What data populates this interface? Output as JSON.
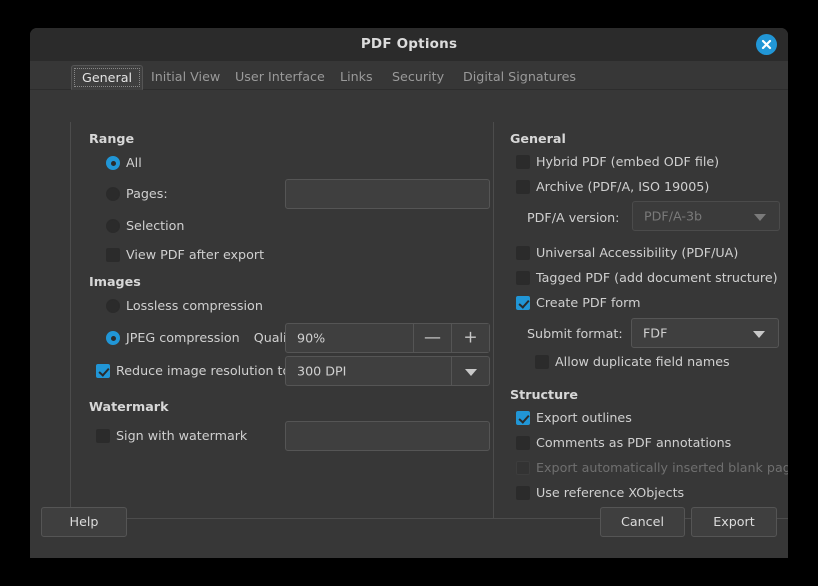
{
  "window": {
    "title": "PDF Options",
    "close_icon": "close-icon"
  },
  "tabs": [
    {
      "label": "General",
      "active": true
    },
    {
      "label": "Initial View",
      "active": false
    },
    {
      "label": "User Interface",
      "active": false
    },
    {
      "label": "Links",
      "active": false
    },
    {
      "label": "Security",
      "active": false
    },
    {
      "label": "Digital Signatures",
      "active": false
    }
  ],
  "left": {
    "range": {
      "title": "Range",
      "all": "All",
      "pages": "Pages:",
      "pages_value": "",
      "selection": "Selection",
      "view_after_export": "View PDF after export"
    },
    "images": {
      "title": "Images",
      "lossless": "Lossless compression",
      "jpeg": "JPEG compression",
      "quality_label": "Quality:",
      "quality_value": "90%",
      "minus": "—",
      "plus": "+",
      "reduce_resolution": "Reduce image resolution to:",
      "resolution_value": "300 DPI"
    },
    "watermark": {
      "title": "Watermark",
      "sign": "Sign with watermark",
      "sign_value": ""
    }
  },
  "right": {
    "general": {
      "title": "General",
      "hybrid": "Hybrid PDF (embed ODF file)",
      "archive": "Archive (PDF/A, ISO 19005)",
      "pdfa_version_label": "PDF/A version:",
      "pdfa_version_value": "PDF/A-3b",
      "universal_accessibility": "Universal Accessibility (PDF/UA)",
      "tagged": "Tagged PDF (add document structure)",
      "create_form": "Create PDF form",
      "submit_format_label": "Submit format:",
      "submit_format_value": "FDF",
      "allow_duplicate": "Allow duplicate field names"
    },
    "structure": {
      "title": "Structure",
      "export_outlines": "Export outlines",
      "comments": "Comments as PDF annotations",
      "blank_pages": "Export automatically inserted blank pages",
      "xobjects": "Use reference XObjects"
    }
  },
  "footer": {
    "help": "Help",
    "cancel": "Cancel",
    "export": "Export"
  },
  "colors": {
    "accent": "#2196d6",
    "dialog_bg": "#373737",
    "titlebar_bg": "#2b2b2b",
    "field_bg": "#3f3f3f",
    "text": "#d0d0d0",
    "text_disabled": "#6f6f6f"
  }
}
